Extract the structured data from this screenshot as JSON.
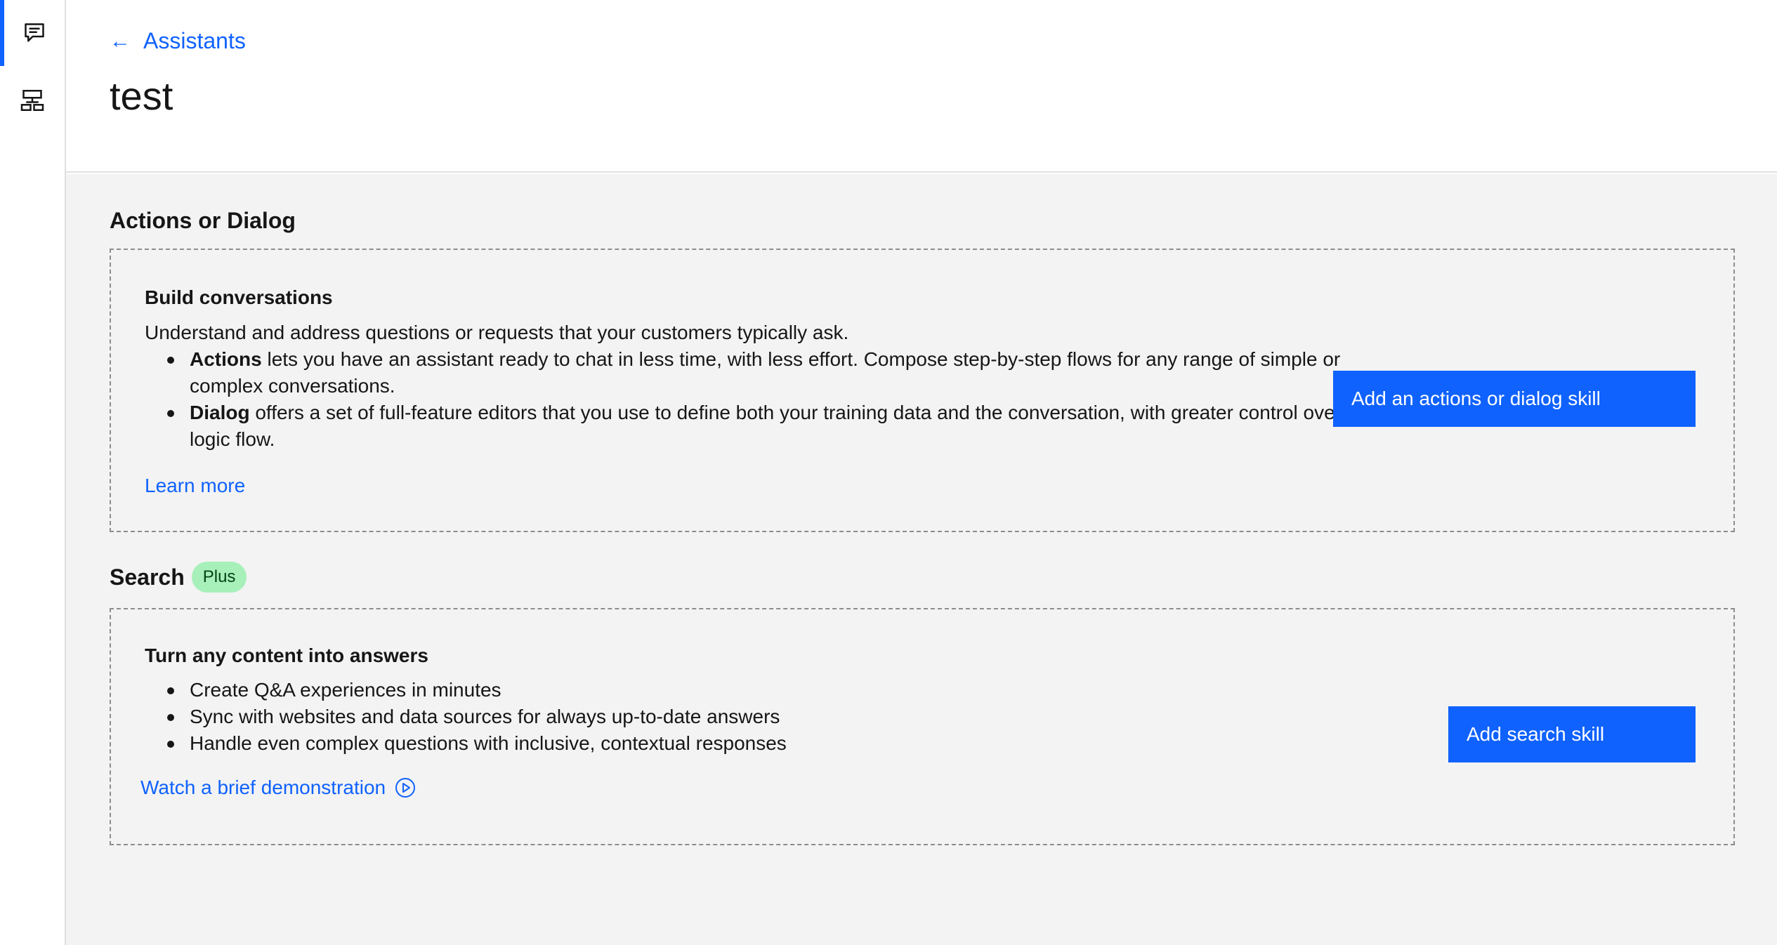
{
  "header": {
    "breadcrumb": "Assistants",
    "title": "test"
  },
  "rail": {
    "items": [
      {
        "icon": "chat-icon",
        "active": true
      },
      {
        "icon": "integrations-icon",
        "active": false
      }
    ]
  },
  "actions_section": {
    "heading": "Actions or Dialog",
    "card_title": "Build conversations",
    "intro": "Understand and address questions or requests that your customers typically ask.",
    "bullets": [
      {
        "strong": "Actions",
        "text": " lets you have an assistant ready to chat in less time, with less effort. Compose step-by-step flows for any range of simple or complex conversations."
      },
      {
        "strong": "Dialog",
        "text": " offers a set of full-feature editors that you use to define both your training data and the conversation, with greater control over the logic flow."
      }
    ],
    "learn_more": "Learn more",
    "button_label": "Add an actions or dialog skill"
  },
  "search_section": {
    "heading": "Search",
    "tag": "Plus",
    "card_title": "Turn any content into answers",
    "bullets": [
      "Create Q&A experiences in minutes",
      "Sync with websites and data sources for always up-to-date answers",
      "Handle even complex questions with inclusive, contextual responses"
    ],
    "demo_link": "Watch a brief demonstration",
    "button_label": "Add search skill"
  },
  "colors": {
    "accent": "#0f62fe",
    "tag_bg": "#a7f0ba",
    "main_bg": "#f3f3f3"
  }
}
